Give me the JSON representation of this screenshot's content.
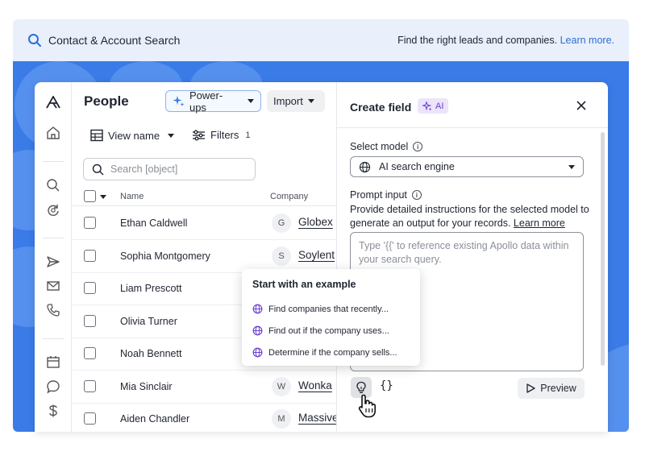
{
  "banner": {
    "title": "Contact & Account Search",
    "tagline": "Find the right leads and companies.",
    "learn_more": "Learn more."
  },
  "people": {
    "title": "People",
    "powerups_label": "Power-ups",
    "import_label": "Import",
    "view_label": "View name",
    "filters_label": "Filters",
    "filters_count": "1",
    "search_placeholder": "Search [object]",
    "columns": {
      "name": "Name",
      "company": "Company"
    },
    "rows": [
      {
        "name": "Ethan Caldwell",
        "logo": "G",
        "company": "Globex"
      },
      {
        "name": "Sophia Montgomery",
        "logo": "S",
        "company": "Soylent"
      },
      {
        "name": "Liam Prescott",
        "logo": "",
        "company": ""
      },
      {
        "name": "Olivia Turner",
        "logo": "",
        "company": ""
      },
      {
        "name": "Noah Bennett",
        "logo": "",
        "company": ""
      },
      {
        "name": "Mia Sinclair",
        "logo": "W",
        "company": "Wonka"
      },
      {
        "name": "Aiden Chandler",
        "logo": "M",
        "company": "Massive"
      }
    ]
  },
  "examples": {
    "title": "Start with an example",
    "items": [
      "Find companies that recently...",
      "Find out if the company uses...",
      "Determine if the company sells..."
    ]
  },
  "create_field": {
    "title": "Create field",
    "ai_badge": "AI",
    "model_label": "Select model",
    "model_value": "AI search engine",
    "prompt_label": "Prompt input",
    "prompt_desc": "Provide detailed instructions for the selected model to generate an output for your records.",
    "prompt_learn_more": "Learn more",
    "prompt_placeholder": "Type '{{' to reference existing Apollo data within your search query.",
    "brace_label": "{}",
    "preview_label": "Preview"
  },
  "colors": {
    "backdrop": "#3a7be8",
    "accent": "#2b6fd6",
    "ai_purple": "#6b3fc9"
  }
}
